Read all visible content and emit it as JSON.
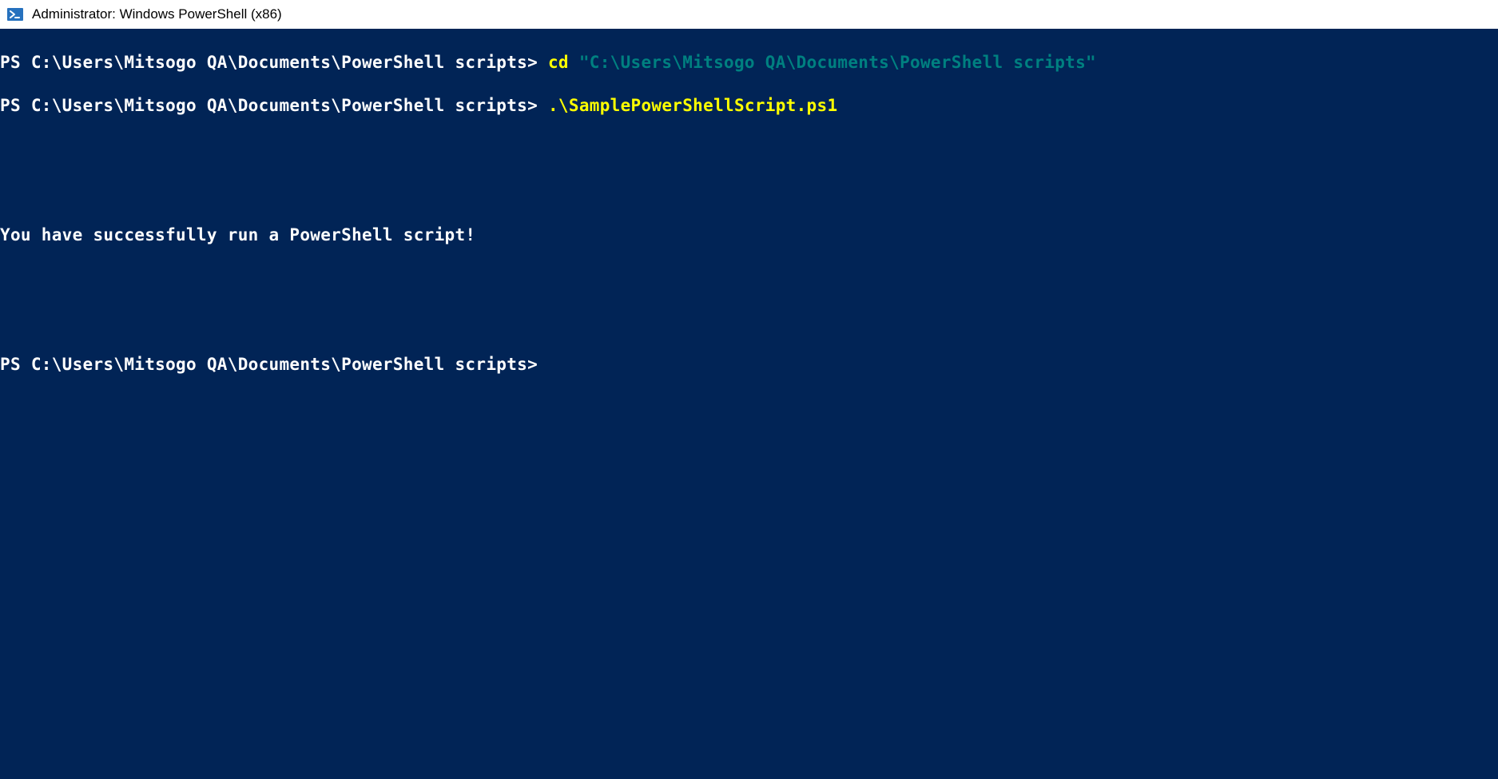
{
  "window": {
    "title": "Administrator: Windows PowerShell (x86)"
  },
  "terminal": {
    "line1": {
      "prompt": "PS C:\\Users\\Mitsogo QA\\Documents\\PowerShell scripts> ",
      "cmd": "cd ",
      "arg": "\"C:\\Users\\Mitsogo QA\\Documents\\PowerShell scripts\""
    },
    "line2": {
      "prompt": "PS C:\\Users\\Mitsogo QA\\Documents\\PowerShell scripts> ",
      "cmd": ".\\SamplePowerShellScript.ps1"
    },
    "output1": "You have successfully run a PowerShell script!",
    "line3": {
      "prompt": "PS C:\\Users\\Mitsogo QA\\Documents\\PowerShell scripts>"
    }
  }
}
